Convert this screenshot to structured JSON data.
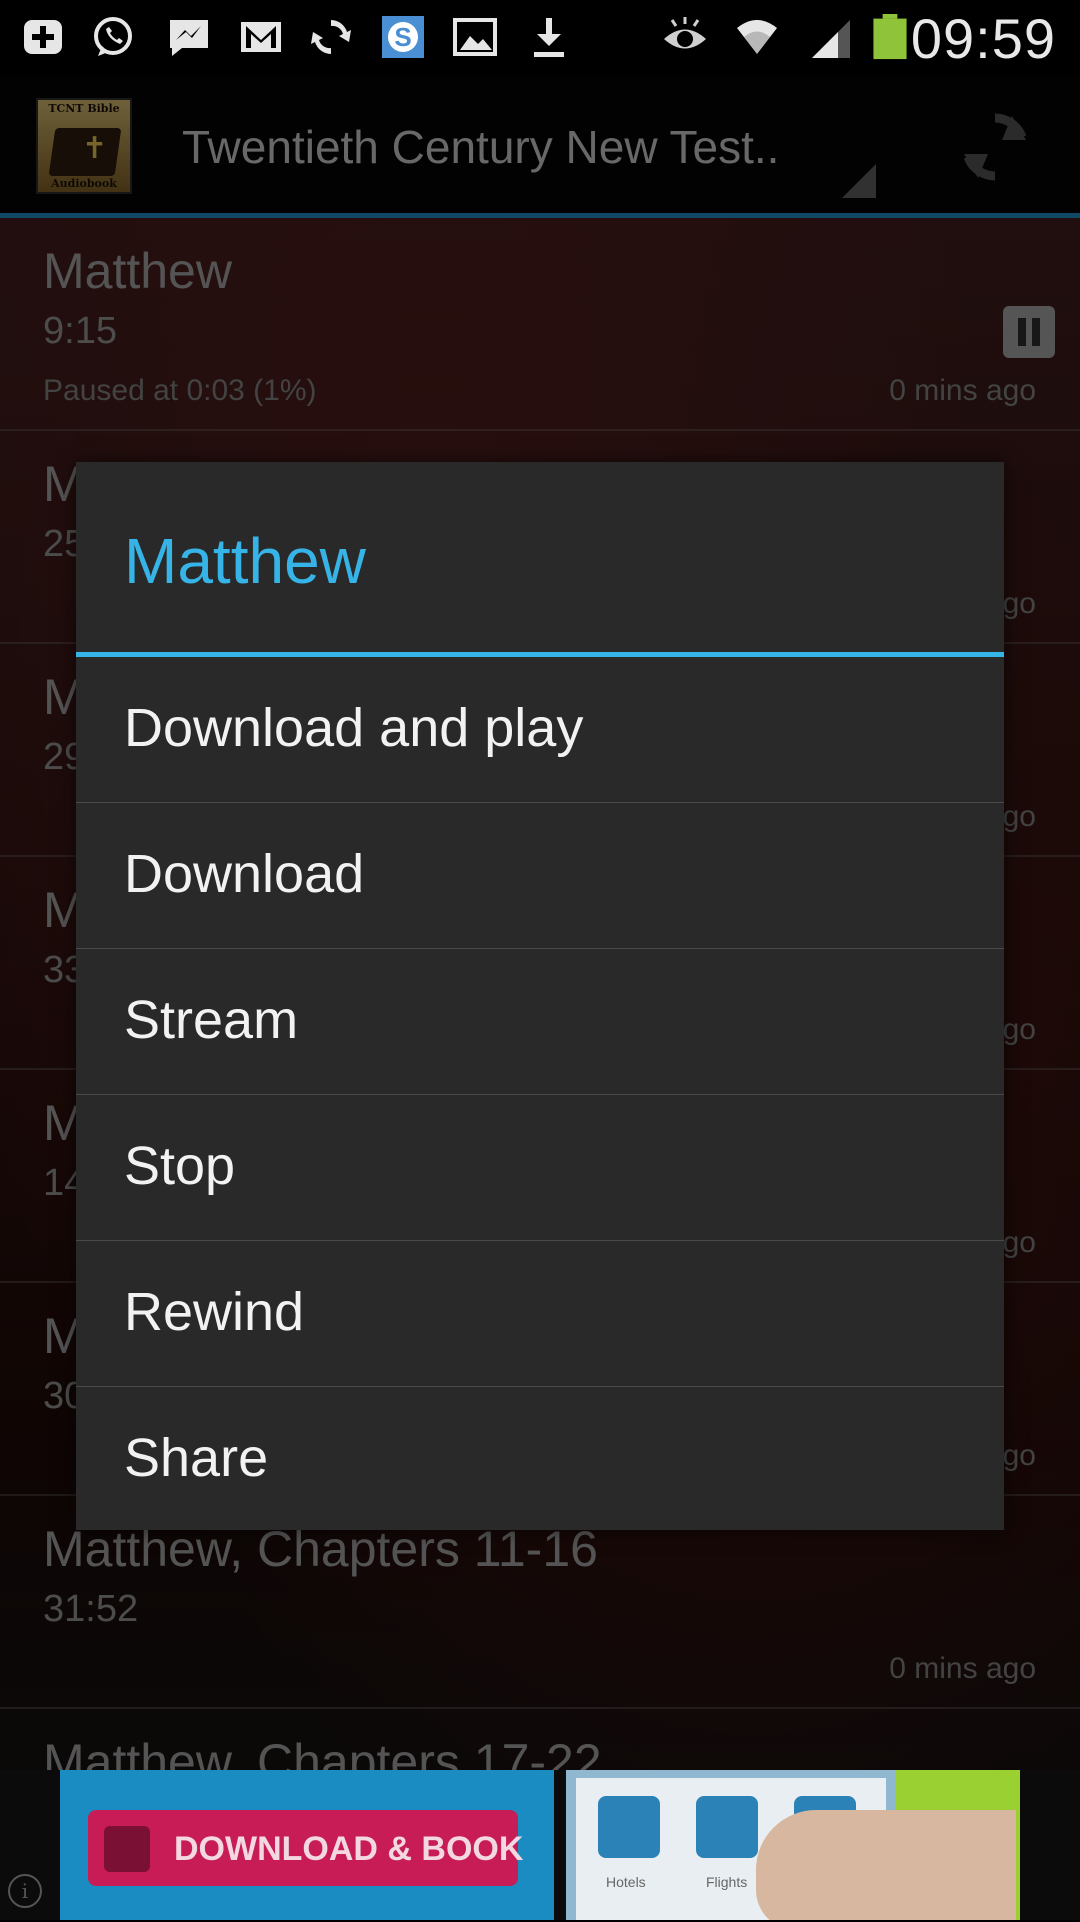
{
  "status_bar": {
    "time": "09:59",
    "icons": [
      "add-notification-icon",
      "whatsapp-icon",
      "messenger-icon",
      "gmail-icon",
      "sync-icon",
      "skype-icon",
      "gallery-icon",
      "download-icon",
      "eye-icon",
      "wifi-icon",
      "signal-icon",
      "battery-icon"
    ]
  },
  "action_bar": {
    "app_title": "Twentieth Century New Test..",
    "logo_top_text": "TCNT Bible",
    "logo_bottom_text": "Audiobook"
  },
  "list": {
    "rows": [
      {
        "title": "Matthew",
        "duration": "9:15",
        "status": "Paused at 0:03 (1%)",
        "ago": "0 mins ago"
      },
      {
        "title": "M",
        "duration": "25",
        "status": "",
        "ago": "go"
      },
      {
        "title": "M",
        "duration": "29",
        "status": "",
        "ago": "go"
      },
      {
        "title": "M",
        "duration": "33",
        "status": "",
        "ago": "go"
      },
      {
        "title": "M",
        "duration": "14",
        "status": "",
        "ago": "go"
      },
      {
        "title": "M",
        "duration": "30",
        "status": "",
        "ago": "go"
      },
      {
        "title": "Matthew, Chapters 11-16",
        "duration": "31:52",
        "status": "",
        "ago": "0 mins ago"
      },
      {
        "title": "Matthew, Chapters 17-22",
        "duration": "",
        "status": "",
        "ago": ""
      }
    ]
  },
  "dialog": {
    "title": "Matthew",
    "items": [
      "Download and play",
      "Download",
      "Stream",
      "Stop",
      "Rewind",
      "Share"
    ]
  },
  "ad": {
    "button_label": "DOWNLOAD & BOOK",
    "tile_labels": [
      "Hotels",
      "Flights",
      ""
    ]
  },
  "colors": {
    "accent": "#36b4e7",
    "dialog_bg": "#292929",
    "ad_button": "#c81c56"
  }
}
